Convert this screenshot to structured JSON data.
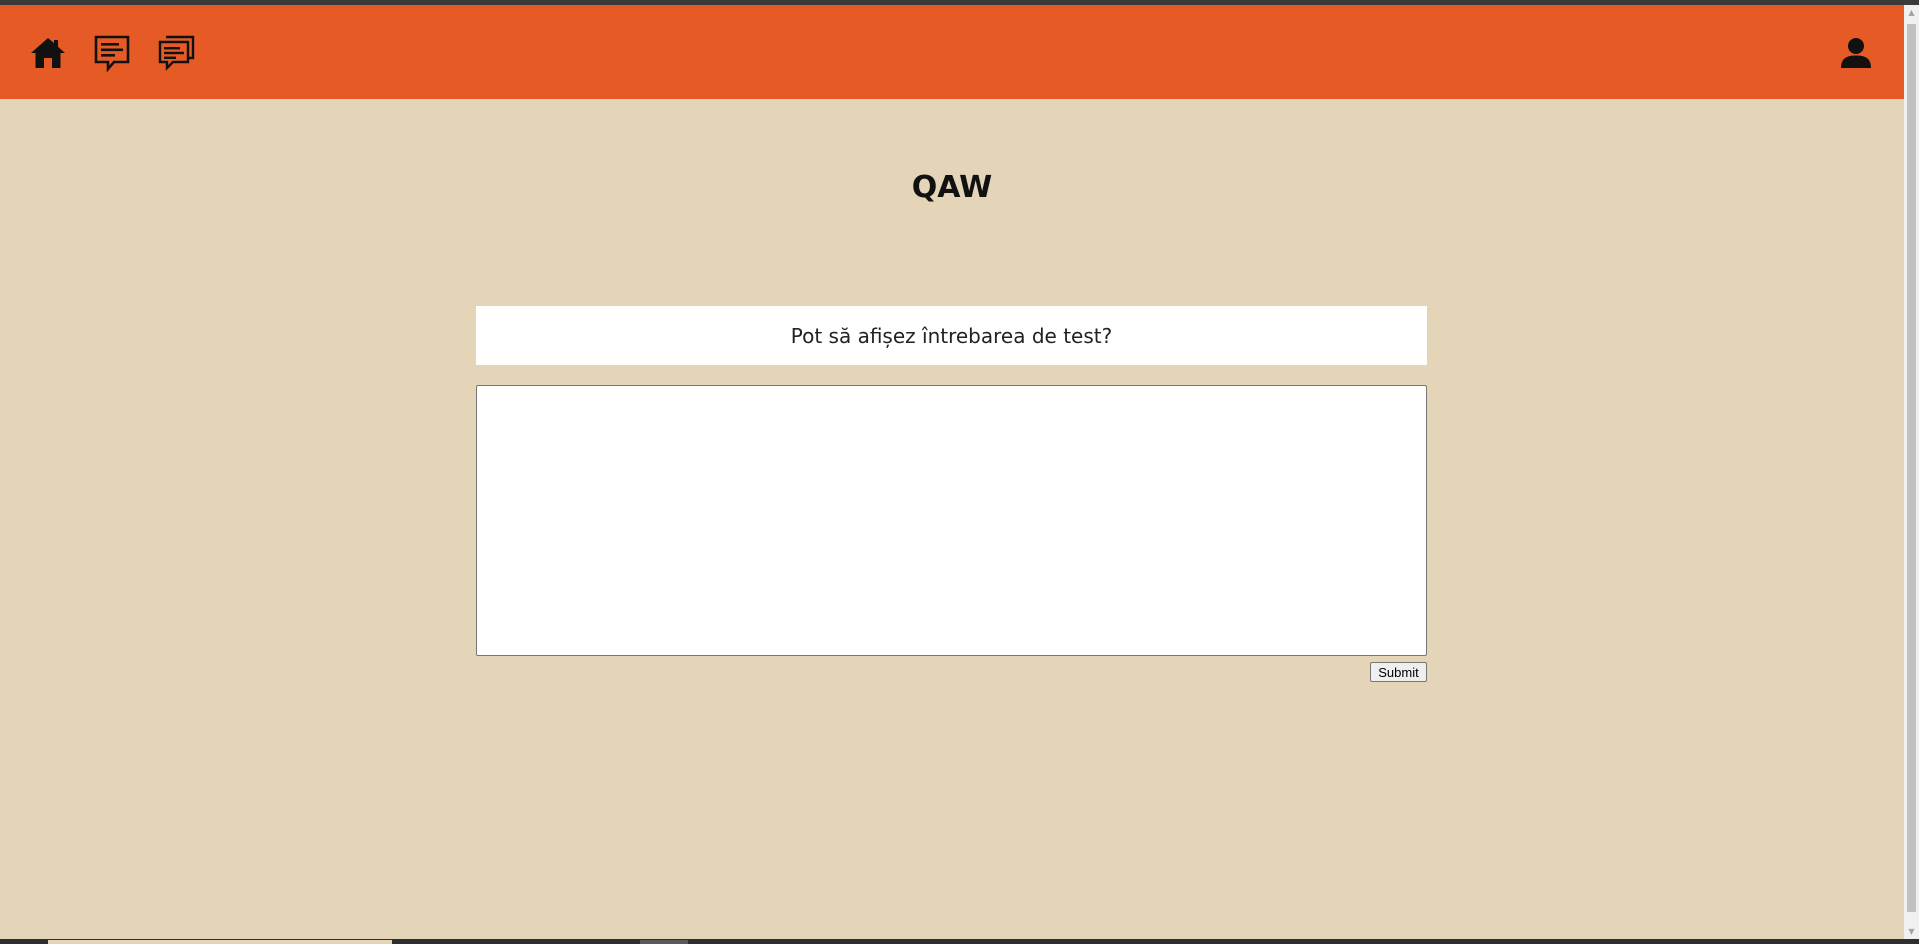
{
  "navbar": {
    "color": "#e55a25",
    "left_icons": [
      "home-icon",
      "message-icon",
      "messages-icon"
    ],
    "right_icon": "user-icon"
  },
  "page": {
    "background": "#e4d5b9",
    "title": "QAW"
  },
  "question": {
    "text": "Pot să afișez întrebarea de test?"
  },
  "answer": {
    "value": "",
    "placeholder": ""
  },
  "submit": {
    "label": "Submit"
  }
}
